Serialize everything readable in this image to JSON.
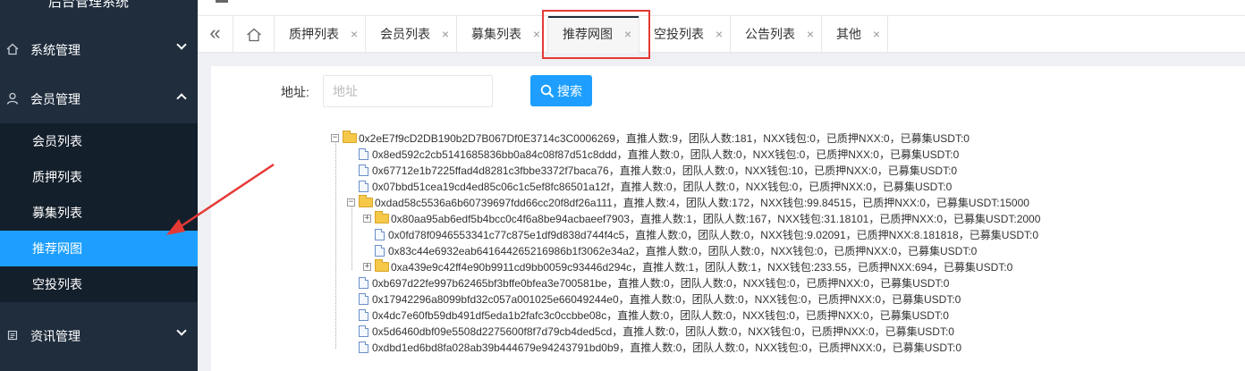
{
  "sidebar": {
    "brand": "后台管理系统",
    "groups": [
      {
        "label": "系统管理",
        "icon": "home-icon"
      },
      {
        "label": "会员管理",
        "icon": "user-icon"
      },
      {
        "label": "资讯管理",
        "icon": "document-icon"
      }
    ],
    "sub_items": [
      "会员列表",
      "质押列表",
      "募集列表",
      "推荐网图",
      "空投列表"
    ],
    "active_sub": "推荐网图"
  },
  "tabs": {
    "items": [
      "质押列表",
      "会员列表",
      "募集列表",
      "推荐网图",
      "空投列表",
      "公告列表",
      "其他"
    ],
    "active": "推荐网图",
    "close_glyph": "×"
  },
  "search": {
    "label": "地址:",
    "placeholder": "地址",
    "value": "",
    "button_label": "搜索"
  },
  "tree": [
    {
      "level": 0,
      "type": "folder",
      "state": "expanded",
      "text": "0x2eE7f9cD2DB190b2D7B067Df0E3714c3C0006269，直推人数:9，团队人数:181，NXX钱包:0，已质押NXX:0，已募集USDT:0"
    },
    {
      "level": 1,
      "type": "file",
      "text": "0x8ed592c2cb5141685836bb0a84c08f87d51c8ddd，直推人数:0，团队人数:0，NXX钱包:0，已质押NXX:0，已募集USDT:0"
    },
    {
      "level": 1,
      "type": "file",
      "text": "0x67712e1b7225ffad4d8281c3fbbe3372f7baca76，直推人数:0，团队人数:0，NXX钱包:10，已质押NXX:0，已募集USDT:0"
    },
    {
      "level": 1,
      "type": "file",
      "text": "0x07bbd51cea19cd4ed85c06c1c5ef8fc86501a12f，直推人数:0，团队人数:0，NXX钱包:0，已质押NXX:0，已募集USDT:0"
    },
    {
      "level": 1,
      "type": "folder",
      "state": "expanded",
      "text": "0xdad58c5536a6b60739697fdd66cc20f8df26a111，直推人数:4，团队人数:172，NXX钱包:99.84515，已质押NXX:0，已募集USDT:15000"
    },
    {
      "level": 2,
      "type": "folder",
      "state": "collapsed",
      "text": "0x80aa95ab6edf5b4bcc0c4f6a8be94acbaeef7903，直推人数:1，团队人数:167，NXX钱包:31.18101，已质押NXX:0，已募集USDT:2000"
    },
    {
      "level": 2,
      "type": "file",
      "text": "0x0fd78f0946553341c77c875e1df9d838d744f4c5，直推人数:0，团队人数:0，NXX钱包:9.02091，已质押NXX:8.181818，已募集USDT:0"
    },
    {
      "level": 2,
      "type": "file",
      "text": "0x83c44e6932eab641644265216986b1f3062e34a2，直推人数:0，团队人数:0，NXX钱包:0，已质押NXX:0，已募集USDT:0"
    },
    {
      "level": 2,
      "type": "folder",
      "state": "collapsed",
      "text": "0xa439e9c42ff4e90b9911cd9bb0059c93446d294c，直推人数:1，团队人数:1，NXX钱包:233.55，已质押NXX:694，已募集USDT:0"
    },
    {
      "level": 1,
      "type": "file",
      "text": "0xb697d22fe997b62465bf3bffe0bfea3e700581be，直推人数:0，团队人数:0，NXX钱包:0，已质押NXX:0，已募集USDT:0"
    },
    {
      "level": 1,
      "type": "file",
      "text": "0x17942296a8099bfd32c057a001025e66049244e0，直推人数:0，团队人数:0，NXX钱包:0，已质押NXX:0，已募集USDT:0"
    },
    {
      "level": 1,
      "type": "file",
      "text": "0x4dc7e60fb59db491df5eda1b2fafc3c0ccbbe08c，直推人数:0，团队人数:0，NXX钱包:0，已质押NXX:0，已募集USDT:0"
    },
    {
      "level": 1,
      "type": "file",
      "text": "0x5d6460dbf09e5508d2275600f8f7d79cb4ded5cd，直推人数:0，团队人数:0，NXX钱包:0，已质押NXX:0，已募集USDT:0"
    },
    {
      "level": 1,
      "type": "file",
      "text": "0xdbd1ed6bd8fa028ab39b444679e94243791bd0b9，直推人数:0，团队人数:0，NXX钱包:0，已质押NXX:0，已募集USDT:0"
    }
  ],
  "colors": {
    "sidebar_bg": "#1f2d3d",
    "submenu_bg": "#131f2b",
    "accent": "#1e9fff",
    "highlight_border": "#e53935",
    "annotation_arrow": "#e53935"
  }
}
